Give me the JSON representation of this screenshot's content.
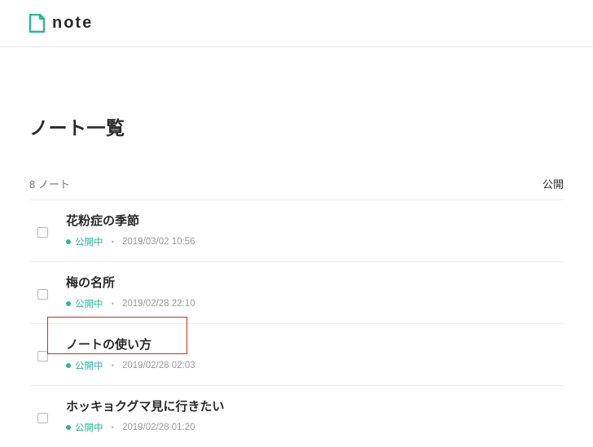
{
  "brand": {
    "name": "note"
  },
  "page": {
    "title": "ノート一覧"
  },
  "count": {
    "value": "8",
    "unit": "ノート",
    "right_label": "公開"
  },
  "notes": [
    {
      "title": "花粉症の季節",
      "status": "公開中",
      "date": "2019/03/02 10:56"
    },
    {
      "title": "梅の名所",
      "status": "公開中",
      "date": "2019/02/28 22:10"
    },
    {
      "title": "ノートの使い方",
      "status": "公開中",
      "date": "2019/02/28 02:03"
    },
    {
      "title": "ホッキョクグマ見に行きたい",
      "status": "公開中",
      "date": "2019/02/28 01:20"
    }
  ],
  "colors": {
    "accent": "#2cb696"
  }
}
